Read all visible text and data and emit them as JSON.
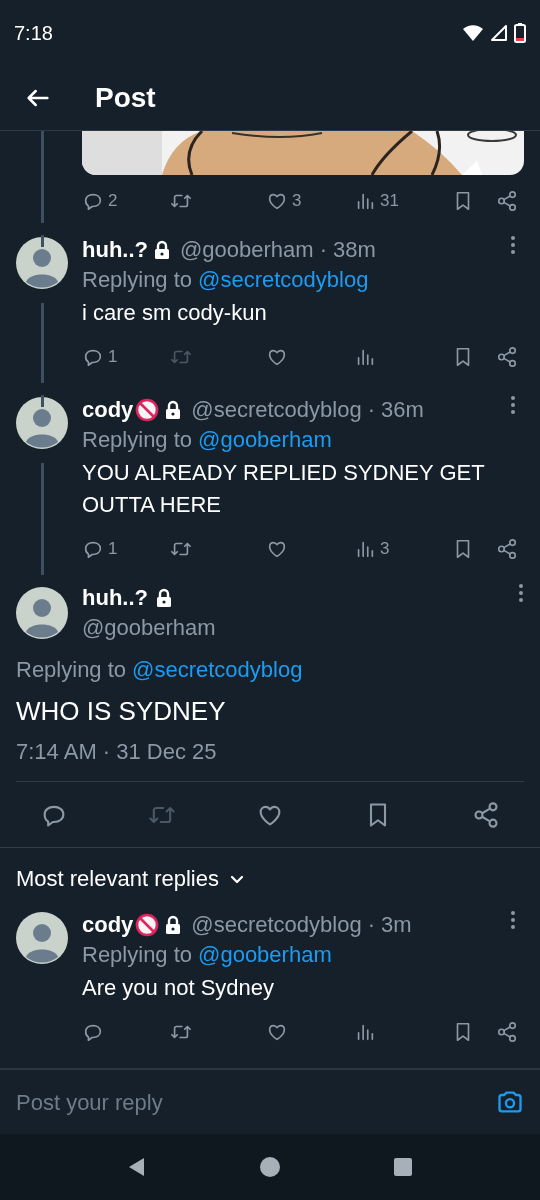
{
  "status_bar": {
    "time": "7:18"
  },
  "header": {
    "title": "Post"
  },
  "previous_post": {
    "retweet_disabled": false,
    "stats": {
      "replies": "2",
      "likes": "3",
      "views": "31"
    }
  },
  "replies_above": [
    {
      "name": "huh..?",
      "age_restricted_badge": false,
      "locked": true,
      "handle": "@gooberham",
      "separator": "·",
      "time": "38m",
      "replying_label": "Replying to",
      "replying_to": "@secretcodyblog",
      "text": "i care sm cody-kun",
      "retweet_disabled": true,
      "stats": {
        "replies": "1"
      }
    },
    {
      "name": "cody",
      "age_restricted_badge": true,
      "locked": true,
      "handle": "@secretcodyblog",
      "separator": "·",
      "time": "36m",
      "replying_label": "Replying to",
      "replying_to": "@gooberham",
      "text": "YOU ALREADY REPLIED SYDNEY GET OUTTA HERE",
      "retweet_disabled": false,
      "stats": {
        "replies": "1",
        "views": "3"
      }
    }
  ],
  "main_post": {
    "name": "huh..?",
    "age_restricted_badge": false,
    "locked": true,
    "handle": "@gooberham",
    "replying_label": "Replying to",
    "replying_to": "@secretcodyblog",
    "text": "WHO IS SYDNEY",
    "timestamp": "7:14 AM · 31 Dec 25",
    "retweet_disabled": true
  },
  "sort": {
    "label": "Most relevant replies"
  },
  "replies_below": [
    {
      "name": "cody",
      "age_restricted_badge": true,
      "locked": true,
      "handle": "@secretcodyblog",
      "separator": "·",
      "time": "3m",
      "replying_label": "Replying to",
      "replying_to": "@gooberham",
      "text": "Are you not Sydney",
      "retweet_disabled": false
    }
  ],
  "composer": {
    "placeholder": "Post your reply"
  }
}
